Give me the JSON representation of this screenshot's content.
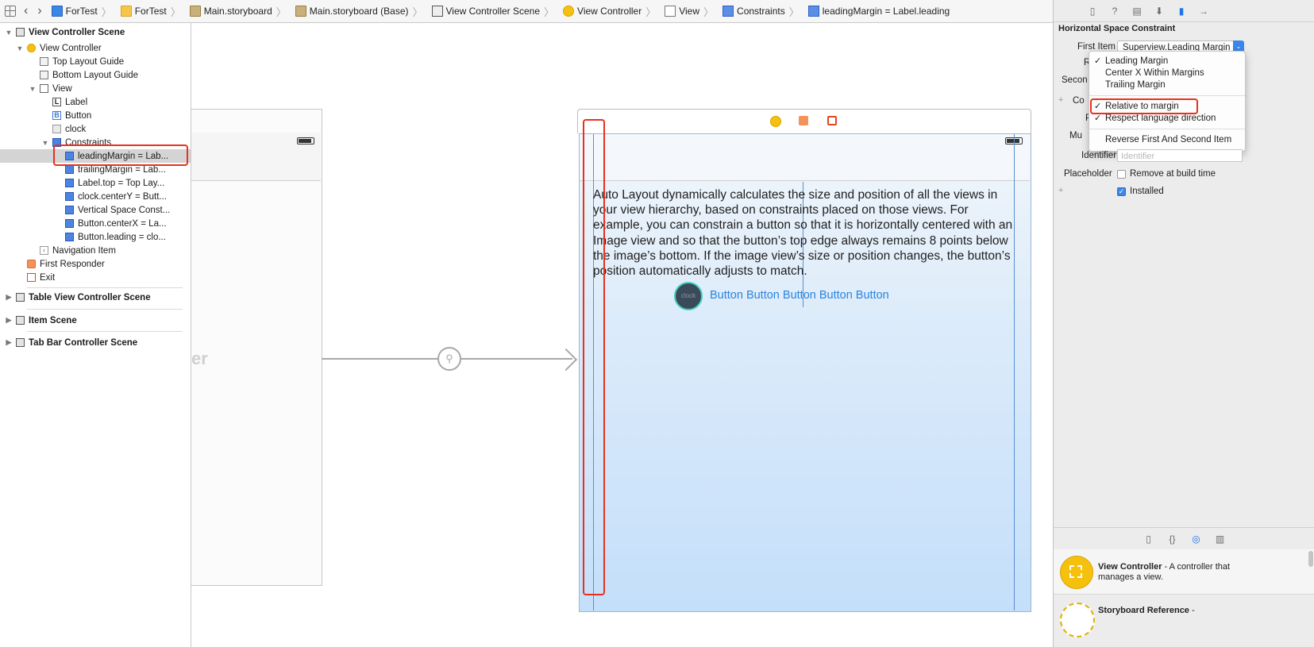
{
  "jumpbar": {
    "crumbs": [
      {
        "label": "ForTest",
        "icon": "project-icon"
      },
      {
        "label": "ForTest",
        "icon": "folder-icon"
      },
      {
        "label": "Main.storyboard",
        "icon": "storyboard-icon"
      },
      {
        "label": "Main.storyboard (Base)",
        "icon": "storyboard-icon"
      },
      {
        "label": "View Controller Scene",
        "icon": "scene-icon"
      },
      {
        "label": "View Controller",
        "icon": "view-controller-icon"
      },
      {
        "label": "View",
        "icon": "view-icon"
      },
      {
        "label": "Constraints",
        "icon": "constraints-icon"
      },
      {
        "label": "leadingMargin = Label.leading",
        "icon": "constraint-icon"
      }
    ]
  },
  "navigator": {
    "rows": [
      {
        "label": "View Controller Scene"
      },
      {
        "label": "View Controller"
      },
      {
        "label": "Top Layout Guide"
      },
      {
        "label": "Bottom Layout Guide"
      },
      {
        "label": "View"
      },
      {
        "label": "Label"
      },
      {
        "label": "Button"
      },
      {
        "label": "clock"
      },
      {
        "label": "Constraints"
      },
      {
        "label": "leadingMargin = Lab..."
      },
      {
        "label": "trailingMargin = Lab..."
      },
      {
        "label": "Label.top = Top Lay..."
      },
      {
        "label": "clock.centerY = Butt..."
      },
      {
        "label": "Vertical Space Const..."
      },
      {
        "label": "Button.centerX = La..."
      },
      {
        "label": "Button.leading = clo..."
      },
      {
        "label": "Navigation Item"
      },
      {
        "label": "First Responder"
      },
      {
        "label": "Exit"
      }
    ],
    "scenes": [
      {
        "label": "Table View Controller Scene"
      },
      {
        "label": "Item Scene"
      },
      {
        "label": "Tab Bar Controller Scene"
      }
    ]
  },
  "canvas": {
    "faded_scene_text": "er",
    "body_text": "Auto Layout dynamically calculates the size and position of all the views in your view hierarchy, based on constraints placed on those views. For example, you can constrain a button so that it is horizontally centered with an Image view and so that the button’s top edge always remains 8 points below the image’s bottom. If the image view’s size or position changes, the button’s position automatically adjusts to match.",
    "button_text": "Button Button Button Button Button",
    "clock_text": "clock"
  },
  "inspector": {
    "title": "Horizontal Space Constraint",
    "first_item_label": "First Item",
    "first_item_value": "Superview.Leading Margin",
    "relation_label_partial": "R",
    "second_label_partial": "Secon",
    "constant_label_partial": "Co",
    "priority_label_partial": "P",
    "multiplier_label_partial": "Mu",
    "menu_items": [
      {
        "label": "Leading Margin",
        "checked": true
      },
      {
        "label": "Center X Within Margins",
        "checked": false
      },
      {
        "label": "Trailing Margin",
        "checked": false
      },
      {
        "label": "Relative to margin",
        "checked": true
      },
      {
        "label": "Respect language direction",
        "checked": true
      },
      {
        "label": "Reverse First And Second Item",
        "checked": false
      }
    ],
    "identifier_label": "Identifier",
    "identifier_placeholder": "Identifier",
    "placeholder_label": "Placeholder",
    "remove_label": "Remove at build time",
    "installed_label": "Installed"
  },
  "library": {
    "items": [
      {
        "title": "View Controller",
        "desc": " - A controller that manages a view."
      },
      {
        "title": "Storyboard Reference",
        "desc": " -"
      }
    ]
  },
  "colors": {
    "highlight_red": "#e8301c",
    "accent_blue": "#2a84e0",
    "vc_yellow": "#f6c10e"
  }
}
